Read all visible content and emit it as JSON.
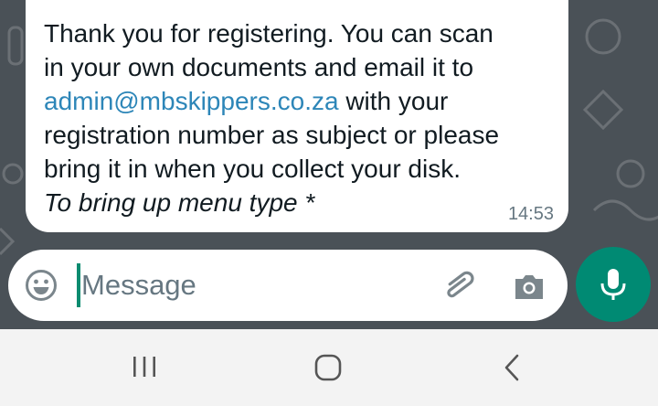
{
  "message": {
    "lines": [
      "Thank you for registering. You can scan",
      "in your own documents and email it to",
      "registration number as subject or please",
      "bring it in when you collect your disk."
    ],
    "email_link": "admin@mbskippers.co.za",
    "email_suffix": " with your",
    "menu_hint": "To bring up menu type *",
    "time": "14:53"
  },
  "composer": {
    "placeholder": "Message",
    "icons": [
      "emoji-icon",
      "paperclip-icon",
      "camera-icon",
      "microphone-icon"
    ]
  },
  "navbar": {
    "icons": [
      "recent-apps-icon",
      "home-icon",
      "back-icon"
    ]
  },
  "colors": {
    "chat_background": "#4a5157",
    "link": "#2d86b8",
    "accent": "#008a73"
  }
}
